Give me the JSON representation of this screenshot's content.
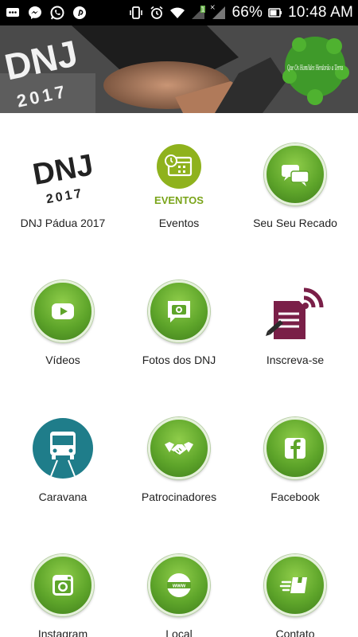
{
  "status_bar": {
    "battery_percent": "66%",
    "time": "10:48 AM",
    "notification_icons": [
      "chat-bubble-icon",
      "messenger-icon",
      "whatsapp-icon",
      "pinterest-icon"
    ],
    "system_icons": [
      "vibrate-icon",
      "alarm-icon",
      "wifi-icon",
      "no-signal-icon",
      "signal-icon",
      "battery-icon"
    ]
  },
  "banner": {
    "logo_text": "DNJ",
    "logo_year": "2017",
    "globe_caption": "Que Os Humildes Herdarão a Terra"
  },
  "menu": [
    {
      "label": "DNJ Pádua 2017",
      "icon": "dnj-logo-icon"
    },
    {
      "label": "Eventos",
      "icon": "calendar-icon",
      "icon_caption": "EVENTOS"
    },
    {
      "label": "Seu Seu Recado",
      "icon": "chat-bubbles-icon"
    },
    {
      "label": "Vídeos",
      "icon": "play-icon"
    },
    {
      "label": "Fotos dos DNJ",
      "icon": "camera-icon"
    },
    {
      "label": "Inscreva-se",
      "icon": "signup-form-icon"
    },
    {
      "label": "Caravana",
      "icon": "bus-icon"
    },
    {
      "label": "Patrocinadores",
      "icon": "handshake-icon"
    },
    {
      "label": "Facebook",
      "icon": "facebook-icon"
    },
    {
      "label": "Instagram",
      "icon": "instagram-icon"
    },
    {
      "label": "Local",
      "icon": "www-globe-icon"
    },
    {
      "label": "Contato",
      "icon": "delivery-box-icon"
    }
  ],
  "colors": {
    "accent_green": "#5ea52a",
    "eventos_green": "#8fb21d",
    "caravana_teal": "#1f7d8a",
    "inscreva_purple": "#7a1f48"
  }
}
